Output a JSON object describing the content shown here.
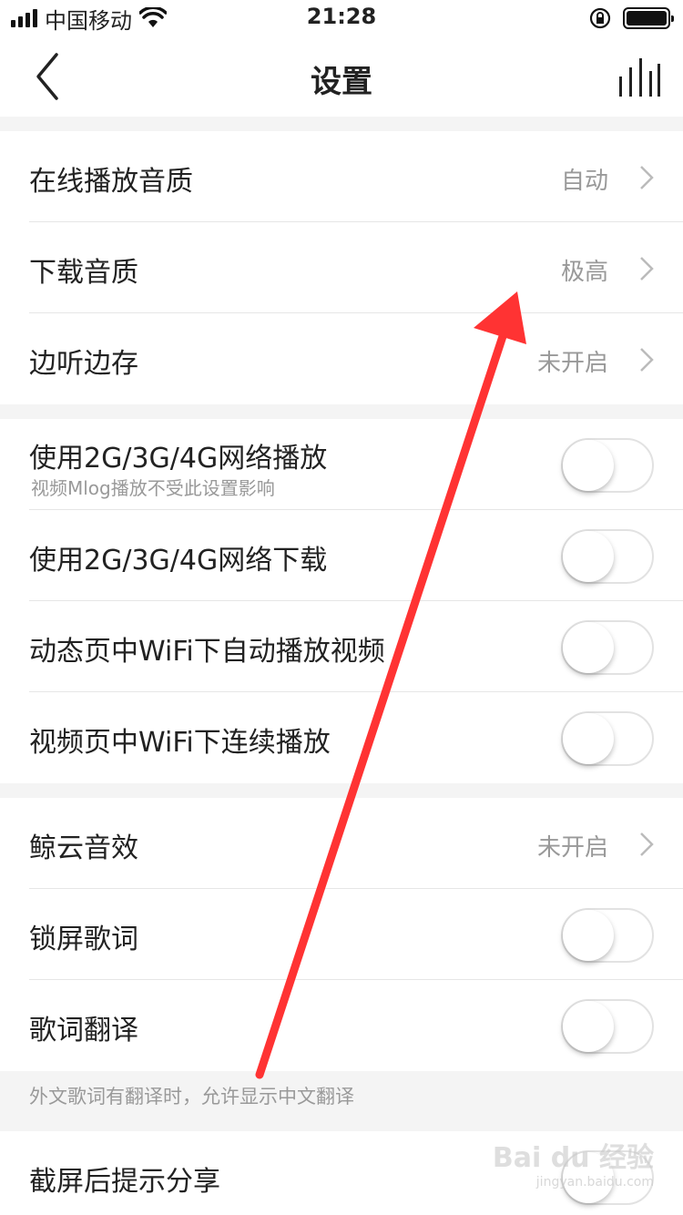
{
  "status_bar": {
    "carrier": "中国移动",
    "time": "21:28"
  },
  "nav": {
    "title": "设置",
    "back_icon": "chevron-left-icon",
    "right_icon": "equalizer-bars-icon"
  },
  "groups": [
    {
      "rows": [
        {
          "title": "在线播放音质",
          "value": "自动",
          "control": "chevron"
        },
        {
          "title": "下载音质",
          "value": "极高",
          "control": "chevron"
        },
        {
          "title": "边听边存",
          "value": "未开启",
          "control": "chevron"
        }
      ]
    },
    {
      "rows": [
        {
          "title": "使用2G/3G/4G网络播放",
          "subtitle": "视频Mlog播放不受此设置影响",
          "control": "toggle",
          "on": false
        },
        {
          "title": "使用2G/3G/4G网络下载",
          "control": "toggle",
          "on": false
        },
        {
          "title": "动态页中WiFi下自动播放视频",
          "control": "toggle",
          "on": false
        },
        {
          "title": "视频页中WiFi下连续播放",
          "control": "toggle",
          "on": false
        }
      ]
    },
    {
      "rows": [
        {
          "title": "鲸云音效",
          "value": "未开启",
          "control": "chevron"
        },
        {
          "title": "锁屏歌词",
          "control": "toggle",
          "on": false
        },
        {
          "title": "歌词翻译",
          "control": "toggle",
          "on": false
        }
      ]
    },
    {
      "rows": [
        {
          "title": "截屏后提示分享",
          "control": "toggle",
          "on": false
        }
      ]
    }
  ],
  "footnote": "外文歌词有翻译时，允许显示中文翻译",
  "watermark": {
    "main": "Bai du 经验",
    "sub": "jingyan.baidu.com"
  },
  "colors": {
    "annotation_arrow": "#ff3333",
    "text_primary": "#222222",
    "text_secondary": "#999999"
  }
}
